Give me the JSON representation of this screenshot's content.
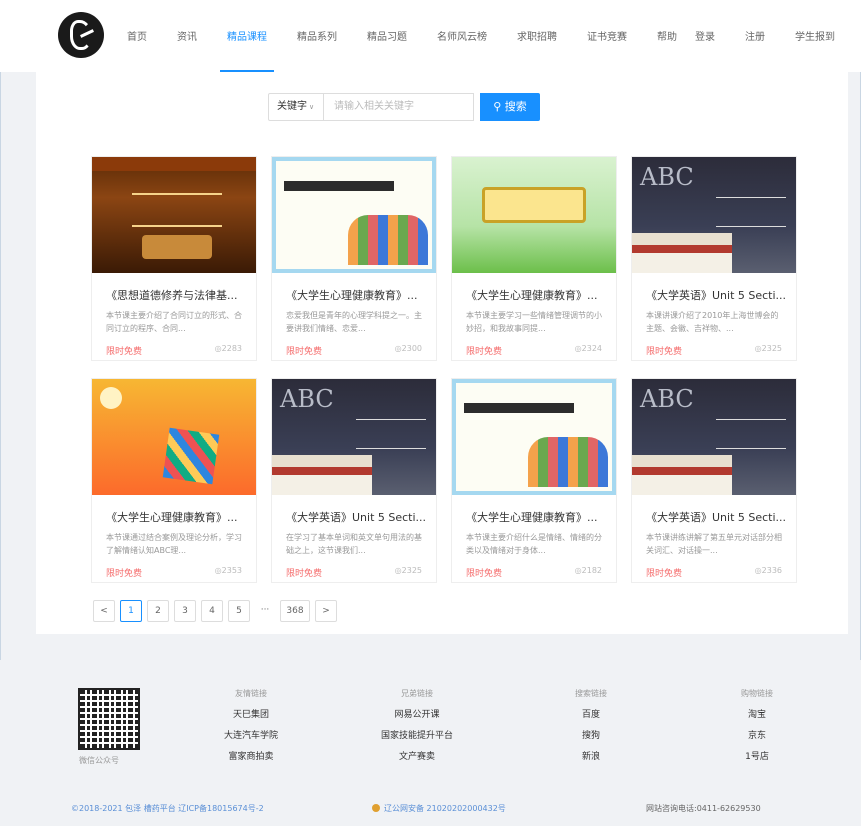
{
  "header": {
    "nav": [
      "首页",
      "资讯",
      "精品课程",
      "精品系列",
      "精品习题",
      "名师风云榜",
      "求职招聘",
      "证书竞赛",
      "帮助"
    ],
    "active_index": 2,
    "auth": [
      "登录",
      "注册",
      "学生报到"
    ]
  },
  "search": {
    "type_label": "关键字",
    "placeholder": "请输入相关关键字",
    "button_label": "搜索"
  },
  "courses": [
    {
      "title": "《思想道德修养与法律基...",
      "desc": "本节课主要介绍了合同订立的形式、合同订立的程序、合同...",
      "price": "限时免费",
      "views": "2283",
      "thumb": "law"
    },
    {
      "title": "《大学生心理健康教育》...",
      "desc": "恋爱我但是青年的心理学科提之一。主要讲我们情绪、恋爱...",
      "price": "限时免费",
      "views": "2300",
      "thumb": "psy"
    },
    {
      "title": "《大学生心理健康教育》...",
      "desc": "本节课主要学习一些情绪管理调节的小妙招，和我故事同提...",
      "price": "限时免费",
      "views": "2324",
      "thumb": "green"
    },
    {
      "title": "《大学英语》Unit 5 Secti...",
      "desc": "本课讲课介绍了2010年上海世博会的主题、会徽、吉祥物、...",
      "price": "限时免费",
      "views": "2325",
      "thumb": "eng"
    },
    {
      "title": "《大学生心理健康教育》...",
      "desc": "本节课通过结合案例及理论分析，学习了解情绪认知ABC理...",
      "price": "限时免费",
      "views": "2353",
      "thumb": "cube"
    },
    {
      "title": "《大学英语》Unit 5 Secti...",
      "desc": "在学习了基本单词和英文单句用法的基础之上，这节课我们...",
      "price": "限时免费",
      "views": "2325",
      "thumb": "eng"
    },
    {
      "title": "《大学生心理健康教育》...",
      "desc": "本节课主要介绍什么是情绪、情绪的分类以及情绪对于身体...",
      "price": "限时免费",
      "views": "2182",
      "thumb": "psy"
    },
    {
      "title": "《大学英语》Unit 5 Secti...",
      "desc": "本节课讲练讲解了第五单元对话部分相关词汇、对话操一...",
      "price": "限时免费",
      "views": "2336",
      "thumb": "eng"
    }
  ],
  "pagination": {
    "prev": "<",
    "pages": [
      "1",
      "2",
      "3",
      "4",
      "5"
    ],
    "active": "1",
    "ellipsis": "···",
    "last": "368",
    "next": ">"
  },
  "footer": {
    "qr_label": "微信公众号",
    "columns": [
      {
        "heading": "友情链接",
        "links": [
          "天巳集团",
          "大连汽车学院",
          "富家商拍卖"
        ]
      },
      {
        "heading": "兄弟链接",
        "links": [
          "网易公开课",
          "国家技能提升平台",
          "文产赛卖"
        ]
      },
      {
        "heading": "搜索链接",
        "links": [
          "百度",
          "搜狗",
          "新浪"
        ]
      },
      {
        "heading": "购物链接",
        "links": [
          "淘宝",
          "京东",
          "1号店"
        ]
      }
    ],
    "copyright": "©2018-2021 包泽 槽药平台 辽ICP备18015674号-2",
    "police": "辽公网安备 21020202000432号",
    "phone": "网站咨询电话:0411-62629530"
  },
  "colors": {
    "accent": "#1890ff",
    "price": "#f56c6c",
    "link": "#5a8fd6"
  }
}
